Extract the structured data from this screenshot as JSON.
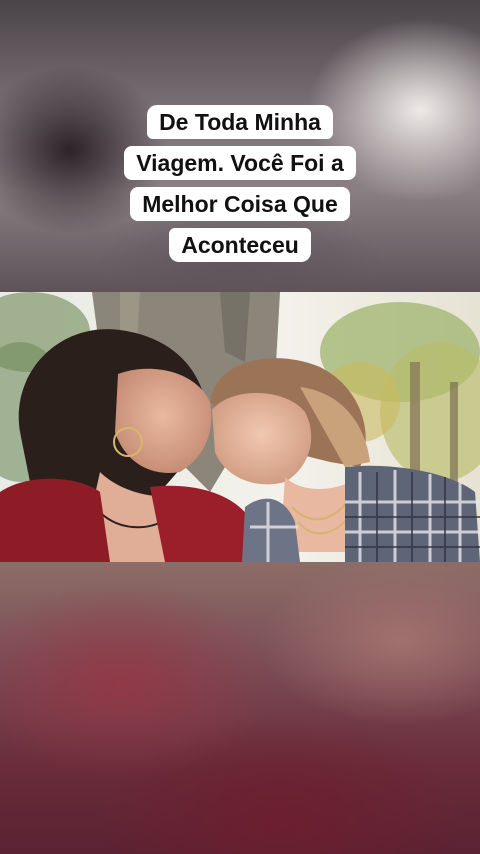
{
  "caption": {
    "lines": [
      "De Toda Minha",
      "Viagem. Você Foi a",
      "Melhor Coisa Que",
      "Aconteceu"
    ]
  },
  "video": {
    "description_icon": "video-still"
  },
  "colors": {
    "caption_bg": "#ffffff",
    "caption_text": "#111111",
    "bottom_tint": "#6a2c3a"
  }
}
